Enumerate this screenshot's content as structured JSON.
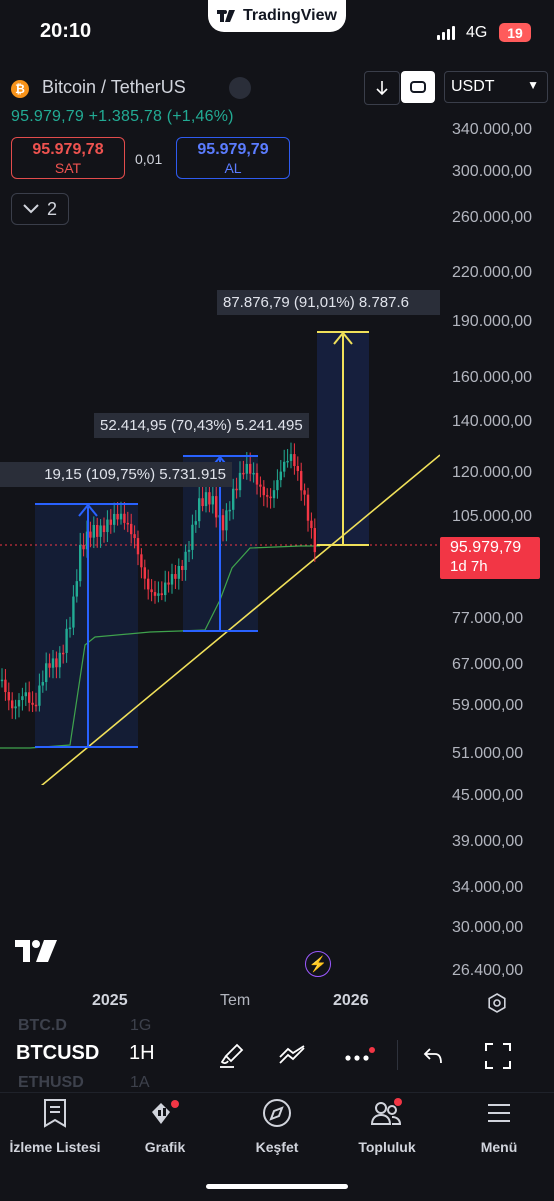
{
  "status_bar": {
    "time": "20:10",
    "network": "4G",
    "battery": "19",
    "app_pill": "TradingView"
  },
  "header": {
    "symbol_title": "Bitcoin / TetherUS",
    "price_line": "95.979,79 +1.385,78 (+1,46%)",
    "currency": "USDT",
    "sell_price": "95.979,78",
    "sell_label": "SAT",
    "spread": "0,01",
    "buy_price": "95.979,79",
    "buy_label": "AL",
    "indicator_count": "2"
  },
  "price_axis": [
    "340.000,00",
    "300.000,00",
    "260.000,00",
    "220.000,00",
    "190.000,00",
    "160.000,00",
    "140.000,00",
    "120.000,00",
    "105.000,00",
    "77.000,00",
    "67.000,00",
    "59.000,00",
    "51.000,00",
    "45.000,00",
    "39.000,00",
    "34.000,00",
    "30.000,00",
    "26.400,00"
  ],
  "price_tag": {
    "value": "95.979,79",
    "countdown": "1d 7h"
  },
  "measurements": {
    "m1": "19,15 (109,75%) 5.731.915",
    "m2": "52.414,95 (70,43%) 5.241.495",
    "m3": "87.876,79 (91,01%) 8.787.6"
  },
  "time_axis": {
    "t1": "2025",
    "t2": "Tem",
    "t3": "2026"
  },
  "toolbar": {
    "symbol": "BTCUSD",
    "interval": "1H",
    "ghost_1": "BTC.D",
    "ghost_2": "1G",
    "ghost_3": "ETHUSD",
    "ghost_4": "1A"
  },
  "nav": {
    "watchlist": "İzleme Listesi",
    "chart": "Grafik",
    "explore": "Keşfet",
    "community": "Topluluk",
    "menu": "Menü"
  },
  "colors": {
    "up": "#22ab94",
    "down": "#f23645",
    "accent_blue": "#2962ff",
    "trendline": "#f0e05a"
  }
}
